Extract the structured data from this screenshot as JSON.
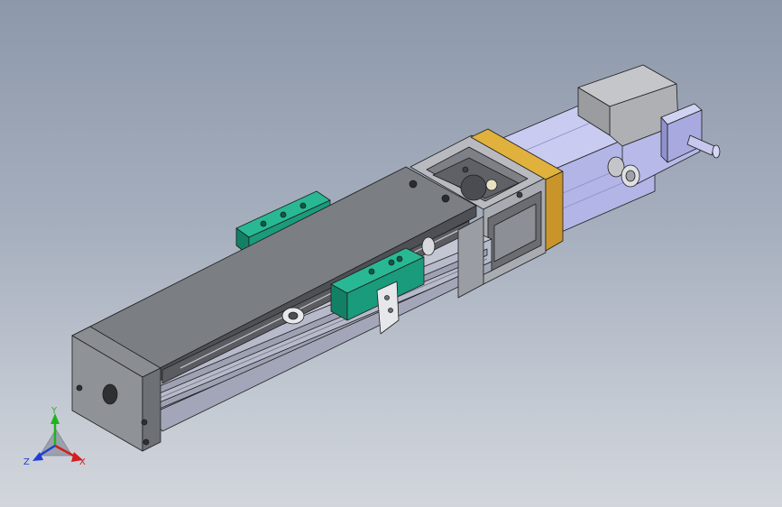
{
  "viewport": {
    "background_top": "#8d98aa",
    "background_bottom": "#d2d6dc"
  },
  "colors": {
    "body_top": "#7b7e83",
    "body_side": "#a6a8ad",
    "rail": "#b7bacb",
    "carriage": "#1a9b7c",
    "coupling_ring": "#d9a531",
    "motor": "#b3b5e6",
    "shaft": "#c6c8ee"
  },
  "triad": {
    "x_label": "X",
    "y_label": "Y",
    "z_label": "Z",
    "x_color": "#d21f1f",
    "y_color": "#1fb31f",
    "z_color": "#1f3fd2"
  }
}
